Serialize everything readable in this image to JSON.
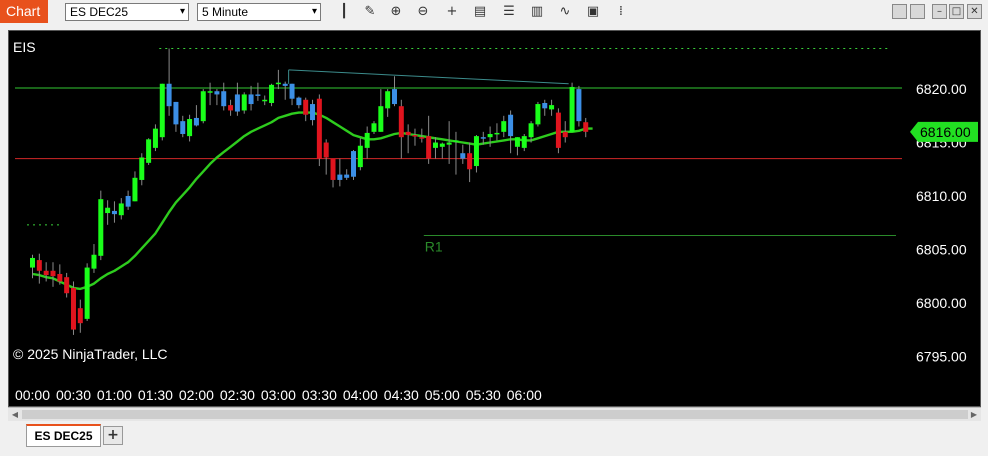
{
  "toolbar": {
    "chart_label": "Chart",
    "instrument": "ES DEC25",
    "interval": "5 Minute",
    "dropdown_arrow": "▾",
    "tools": [
      {
        "name": "bar-type-icon",
        "glyph": "┃"
      },
      {
        "name": "pencil-icon",
        "glyph": "✎"
      },
      {
        "name": "zoom-in-icon",
        "glyph": "⊕"
      },
      {
        "name": "zoom-out-icon",
        "glyph": "⊖"
      },
      {
        "name": "crosshair-icon",
        "glyph": "+"
      },
      {
        "name": "data-box-icon",
        "glyph": "▤"
      },
      {
        "name": "properties-icon",
        "glyph": "☰"
      },
      {
        "name": "indicators-icon",
        "glyph": "▥"
      },
      {
        "name": "strategies-icon",
        "glyph": "∿"
      },
      {
        "name": "templates-icon",
        "glyph": "▣"
      },
      {
        "name": "grid-menu-icon",
        "glyph": "⁞"
      }
    ],
    "window_buttons": [
      {
        "name": "minimize-gray-button",
        "glyph": ""
      },
      {
        "name": "restore-button",
        "glyph": ""
      },
      {
        "name": "minimize-button",
        "glyph": "–"
      },
      {
        "name": "maximize-button",
        "glyph": "□"
      },
      {
        "name": "close-button",
        "glyph": "✕"
      }
    ]
  },
  "tabs": {
    "active": "ES DEC25",
    "add_label": "+"
  },
  "scroll": {
    "left_arrow": "◀",
    "right_arrow": "▶"
  },
  "chart_data": {
    "type": "candlestick",
    "panel_label": "EIS",
    "copyright": "© 2025 NinjaTrader, LLC",
    "ylim": [
      6792.5,
      6824.5
    ],
    "y_ticks": [
      6820,
      6815,
      6810,
      6805,
      6800,
      6795
    ],
    "y_tick_labels": [
      "6820.00",
      "6815.00",
      "6810.00",
      "6805.00",
      "6800.00",
      "6795.00"
    ],
    "x_tick_labels": [
      "00:00",
      "00:30",
      "01:00",
      "01:30",
      "02:00",
      "02:30",
      "03:00",
      "03:30",
      "04:00",
      "04:30",
      "05:00",
      "05:30",
      "06:00"
    ],
    "x_tick_bar_index": [
      0,
      6,
      12,
      18,
      24,
      30,
      36,
      42,
      48,
      54,
      60,
      66,
      72
    ],
    "current_price_label": "6816.00",
    "current_price": 6816.0,
    "colors": {
      "up": "#1aff1a",
      "down": "#e0141e",
      "flat_up": "#3c8fe6",
      "ema": "#2ecc1e",
      "upper_line": "#32c832",
      "lower_line": "#d22828",
      "trend": "#3c8c8c",
      "r1": "#2a8a2a",
      "dotted": "#39d039",
      "price_tag": "#22e022",
      "text": "#ffffff"
    },
    "levels": {
      "upper": 6820.1,
      "lower": 6813.5,
      "r1": 6806.3,
      "r1_label": "R1",
      "r1_start_bar": 57,
      "prior_high_dotted": 6823.8,
      "prior_high_start_bar": 19,
      "prior_low_dotted": 6807.3,
      "prior_low_end_bar": 3
    },
    "trendline": {
      "start_bar": 37.5,
      "start": 6821.8,
      "end_bar": 78.5,
      "end": 6820.5
    },
    "candles": [
      {
        "o": 6803.3,
        "h": 6804.5,
        "l": 6802.3,
        "c": 6804.2,
        "t": "up"
      },
      {
        "o": 6804.0,
        "h": 6804.6,
        "l": 6801.8,
        "c": 6803.0,
        "t": "down"
      },
      {
        "o": 6803.0,
        "h": 6803.8,
        "l": 6802.0,
        "c": 6802.6,
        "t": "down"
      },
      {
        "o": 6803.0,
        "h": 6803.8,
        "l": 6801.5,
        "c": 6802.5,
        "t": "down"
      },
      {
        "o": 6802.7,
        "h": 6803.6,
        "l": 6801.7,
        "c": 6802.0,
        "t": "down"
      },
      {
        "o": 6802.4,
        "h": 6802.8,
        "l": 6800.5,
        "c": 6800.9,
        "t": "down"
      },
      {
        "o": 6801.4,
        "h": 6802.0,
        "l": 6797.0,
        "c": 6797.5,
        "t": "down"
      },
      {
        "o": 6799.5,
        "h": 6800.3,
        "l": 6797.2,
        "c": 6798.1,
        "t": "down"
      },
      {
        "o": 6798.5,
        "h": 6803.7,
        "l": 6798.3,
        "c": 6803.3,
        "t": "up"
      },
      {
        "o": 6803.2,
        "h": 6805.5,
        "l": 6802.8,
        "c": 6804.5,
        "t": "up"
      },
      {
        "o": 6804.4,
        "h": 6810.5,
        "l": 6804.0,
        "c": 6809.7,
        "t": "up"
      },
      {
        "o": 6808.4,
        "h": 6809.6,
        "l": 6807.3,
        "c": 6808.9,
        "t": "up"
      },
      {
        "o": 6808.6,
        "h": 6809.5,
        "l": 6807.5,
        "c": 6808.3,
        "t": "flat"
      },
      {
        "o": 6808.2,
        "h": 6809.8,
        "l": 6807.8,
        "c": 6809.3,
        "t": "up"
      },
      {
        "o": 6809.0,
        "h": 6810.5,
        "l": 6808.7,
        "c": 6810.0,
        "t": "flat"
      },
      {
        "o": 6809.5,
        "h": 6812.3,
        "l": 6809.5,
        "c": 6811.7,
        "t": "up"
      },
      {
        "o": 6811.5,
        "h": 6814.0,
        "l": 6811.0,
        "c": 6813.6,
        "t": "up"
      },
      {
        "o": 6813.1,
        "h": 6815.4,
        "l": 6812.9,
        "c": 6815.3,
        "t": "up"
      },
      {
        "o": 6814.5,
        "h": 6816.7,
        "l": 6814.2,
        "c": 6816.3,
        "t": "up"
      },
      {
        "o": 6815.5,
        "h": 6820.5,
        "l": 6815.2,
        "c": 6820.5,
        "t": "up"
      },
      {
        "o": 6820.5,
        "h": 6823.8,
        "l": 6817.5,
        "c": 6818.4,
        "t": "flat"
      },
      {
        "o": 6818.8,
        "h": 6818.8,
        "l": 6816.0,
        "c": 6816.7,
        "t": "flat"
      },
      {
        "o": 6817.0,
        "h": 6817.5,
        "l": 6815.5,
        "c": 6815.8,
        "t": "flat"
      },
      {
        "o": 6815.6,
        "h": 6817.6,
        "l": 6815.1,
        "c": 6817.2,
        "t": "up"
      },
      {
        "o": 6816.6,
        "h": 6818.5,
        "l": 6816.5,
        "c": 6817.3,
        "t": "flat"
      },
      {
        "o": 6817.0,
        "h": 6820.0,
        "l": 6816.8,
        "c": 6819.8,
        "t": "up"
      },
      {
        "o": 6819.8,
        "h": 6820.6,
        "l": 6818.5,
        "c": 6819.8,
        "t": "up"
      },
      {
        "o": 6819.5,
        "h": 6820.0,
        "l": 6818.5,
        "c": 6819.8,
        "t": "flat"
      },
      {
        "o": 6819.8,
        "h": 6820.6,
        "l": 6818.0,
        "c": 6818.4,
        "t": "flat"
      },
      {
        "o": 6818.5,
        "h": 6819.0,
        "l": 6817.5,
        "c": 6818.0,
        "t": "down"
      },
      {
        "o": 6819.5,
        "h": 6820.6,
        "l": 6817.5,
        "c": 6817.9,
        "t": "flat"
      },
      {
        "o": 6818.0,
        "h": 6819.7,
        "l": 6817.7,
        "c": 6819.5,
        "t": "up"
      },
      {
        "o": 6819.5,
        "h": 6820.3,
        "l": 6818.0,
        "c": 6818.6,
        "t": "flat"
      },
      {
        "o": 6819.5,
        "h": 6820.6,
        "l": 6818.9,
        "c": 6819.4,
        "t": "flat"
      },
      {
        "o": 6819.0,
        "h": 6819.4,
        "l": 6818.5,
        "c": 6819.0,
        "t": "up"
      },
      {
        "o": 6818.7,
        "h": 6820.5,
        "l": 6818.4,
        "c": 6820.4,
        "t": "up"
      },
      {
        "o": 6820.6,
        "h": 6821.8,
        "l": 6820.0,
        "c": 6820.5,
        "t": "up"
      },
      {
        "o": 6820.3,
        "h": 6820.7,
        "l": 6819.0,
        "c": 6820.5,
        "t": "flat"
      },
      {
        "o": 6820.5,
        "h": 6820.5,
        "l": 6818.5,
        "c": 6819.1,
        "t": "flat"
      },
      {
        "o": 6819.2,
        "h": 6819.3,
        "l": 6818.2,
        "c": 6818.5,
        "t": "flat"
      },
      {
        "o": 6819.0,
        "h": 6819.2,
        "l": 6817.0,
        "c": 6817.6,
        "t": "down"
      },
      {
        "o": 6818.6,
        "h": 6819.0,
        "l": 6816.6,
        "c": 6817.1,
        "t": "flat"
      },
      {
        "o": 6819.1,
        "h": 6819.5,
        "l": 6812.8,
        "c": 6813.5,
        "t": "down"
      },
      {
        "o": 6815.0,
        "h": 6815.3,
        "l": 6812.0,
        "c": 6813.6,
        "t": "down"
      },
      {
        "o": 6813.5,
        "h": 6813.5,
        "l": 6810.8,
        "c": 6811.5,
        "t": "down"
      },
      {
        "o": 6812.0,
        "h": 6813.5,
        "l": 6810.9,
        "c": 6811.5,
        "t": "flat"
      },
      {
        "o": 6812.0,
        "h": 6812.5,
        "l": 6811.5,
        "c": 6811.7,
        "t": "flat"
      },
      {
        "o": 6814.2,
        "h": 6814.3,
        "l": 6811.5,
        "c": 6811.8,
        "t": "flat"
      },
      {
        "o": 6812.7,
        "h": 6815.4,
        "l": 6812.4,
        "c": 6814.7,
        "t": "up"
      },
      {
        "o": 6814.5,
        "h": 6816.5,
        "l": 6813.5,
        "c": 6815.9,
        "t": "up"
      },
      {
        "o": 6816.0,
        "h": 6817.0,
        "l": 6815.8,
        "c": 6816.8,
        "t": "up"
      },
      {
        "o": 6816.0,
        "h": 6820.0,
        "l": 6816.0,
        "c": 6818.4,
        "t": "up"
      },
      {
        "o": 6818.2,
        "h": 6820.0,
        "l": 6817.4,
        "c": 6819.8,
        "t": "up"
      },
      {
        "o": 6820.0,
        "h": 6821.2,
        "l": 6818.4,
        "c": 6818.6,
        "t": "flat"
      },
      {
        "o": 6818.4,
        "h": 6819.0,
        "l": 6813.5,
        "c": 6815.5,
        "t": "down"
      },
      {
        "o": 6816.0,
        "h": 6816.7,
        "l": 6814.0,
        "c": 6815.7,
        "t": "down"
      },
      {
        "o": 6815.7,
        "h": 6816.3,
        "l": 6814.7,
        "c": 6815.6,
        "t": "down"
      },
      {
        "o": 6815.5,
        "h": 6816.3,
        "l": 6815.0,
        "c": 6815.5,
        "t": "down"
      },
      {
        "o": 6815.6,
        "h": 6817.5,
        "l": 6813.0,
        "c": 6813.5,
        "t": "down"
      },
      {
        "o": 6815.0,
        "h": 6815.5,
        "l": 6813.5,
        "c": 6814.5,
        "t": "up"
      },
      {
        "o": 6814.9,
        "h": 6815.0,
        "l": 6813.5,
        "c": 6814.6,
        "t": "up"
      },
      {
        "o": 6815.0,
        "h": 6817.0,
        "l": 6813.0,
        "c": 6814.8,
        "t": "up"
      },
      {
        "o": 6815.2,
        "h": 6816.0,
        "l": 6812.0,
        "c": 6815.2,
        "t": "up"
      },
      {
        "o": 6814.0,
        "h": 6814.8,
        "l": 6813.0,
        "c": 6813.5,
        "t": "flat"
      },
      {
        "o": 6814.0,
        "h": 6815.0,
        "l": 6811.3,
        "c": 6812.5,
        "t": "down"
      },
      {
        "o": 6812.8,
        "h": 6815.7,
        "l": 6812.2,
        "c": 6815.6,
        "t": "up"
      },
      {
        "o": 6815.5,
        "h": 6816.0,
        "l": 6814.8,
        "c": 6815.5,
        "t": "flat"
      },
      {
        "o": 6815.5,
        "h": 6816.5,
        "l": 6814.6,
        "c": 6815.8,
        "t": "up"
      },
      {
        "o": 6815.9,
        "h": 6816.8,
        "l": 6815.2,
        "c": 6815.8,
        "t": "up"
      },
      {
        "o": 6816.0,
        "h": 6817.5,
        "l": 6815.5,
        "c": 6817.0,
        "t": "up"
      },
      {
        "o": 6817.6,
        "h": 6818.0,
        "l": 6814.0,
        "c": 6815.6,
        "t": "flat"
      },
      {
        "o": 6815.5,
        "h": 6815.5,
        "l": 6813.8,
        "c": 6814.6,
        "t": "up"
      },
      {
        "o": 6814.5,
        "h": 6815.8,
        "l": 6814.2,
        "c": 6815.6,
        "t": "up"
      },
      {
        "o": 6815.5,
        "h": 6817.0,
        "l": 6815.0,
        "c": 6816.8,
        "t": "up"
      },
      {
        "o": 6816.7,
        "h": 6818.8,
        "l": 6816.5,
        "c": 6818.6,
        "t": "up"
      },
      {
        "o": 6818.7,
        "h": 6819.0,
        "l": 6817.5,
        "c": 6818.2,
        "t": "flat"
      },
      {
        "o": 6818.5,
        "h": 6819.0,
        "l": 6817.5,
        "c": 6818.1,
        "t": "up"
      },
      {
        "o": 6817.8,
        "h": 6818.2,
        "l": 6814.0,
        "c": 6814.5,
        "t": "down"
      },
      {
        "o": 6816.0,
        "h": 6817.0,
        "l": 6815.0,
        "c": 6815.5,
        "t": "down"
      },
      {
        "o": 6816.0,
        "h": 6820.6,
        "l": 6816.0,
        "c": 6820.2,
        "t": "up"
      },
      {
        "o": 6820.0,
        "h": 6820.3,
        "l": 6816.5,
        "c": 6817.0,
        "t": "flat"
      },
      {
        "o": 6816.9,
        "h": 6817.3,
        "l": 6815.5,
        "c": 6816.0,
        "t": "down"
      }
    ],
    "ema": [
      6802.7,
      6802.6,
      6802.4,
      6802.3,
      6802.0,
      6801.7,
      6801.4,
      6801.3,
      6801.5,
      6801.8,
      6802.3,
      6802.7,
      6803.0,
      6803.4,
      6803.8,
      6804.4,
      6805.1,
      6805.8,
      6806.5,
      6807.5,
      6808.5,
      6809.4,
      6810.1,
      6810.8,
      6811.6,
      6812.3,
      6813.0,
      6813.6,
      6814.1,
      6814.6,
      6815.1,
      6815.6,
      6816.0,
      6816.3,
      6816.6,
      6816.9,
      6817.3,
      6817.5,
      6817.7,
      6817.8,
      6817.8,
      6817.8,
      6817.6,
      6817.3,
      6816.9,
      6816.5,
      6816.1,
      6815.7,
      6815.5,
      6815.3,
      6815.3,
      6815.4,
      6815.6,
      6815.8,
      6815.9,
      6815.8,
      6815.7,
      6815.6,
      6815.5,
      6815.4,
      6815.3,
      6815.2,
      6815.1,
      6815.0,
      6814.9,
      6814.8,
      6814.9,
      6815.0,
      6815.1,
      6815.2,
      6815.3,
      6815.3,
      6815.2,
      6815.2,
      6815.4,
      6815.6,
      6815.8,
      6816.0,
      6816.0,
      6816.0,
      6816.1,
      6816.3,
      6816.3
    ]
  }
}
